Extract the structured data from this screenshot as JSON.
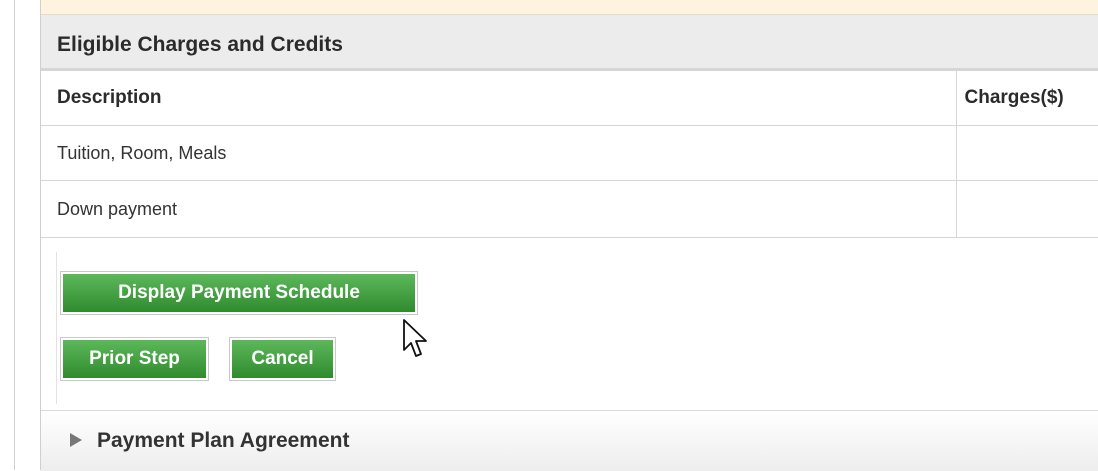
{
  "section": {
    "title": "Eligible Charges and Credits"
  },
  "table": {
    "headers": [
      "Description",
      "Charges($)"
    ],
    "rows": [
      {
        "description": "Tuition, Room, Meals",
        "charges": ""
      },
      {
        "description": "Down payment",
        "charges": ""
      }
    ]
  },
  "buttons": {
    "display_schedule": "Display Payment Schedule",
    "prior_step": "Prior Step",
    "cancel": "Cancel"
  },
  "footer": {
    "title": "Payment Plan Agreement",
    "icon": "triangle-right-icon"
  },
  "colors": {
    "button_top": "#5cb85a",
    "button_bottom": "#2f8b2e",
    "notice_bg": "#fdf3df",
    "header_bg": "#ececec"
  }
}
